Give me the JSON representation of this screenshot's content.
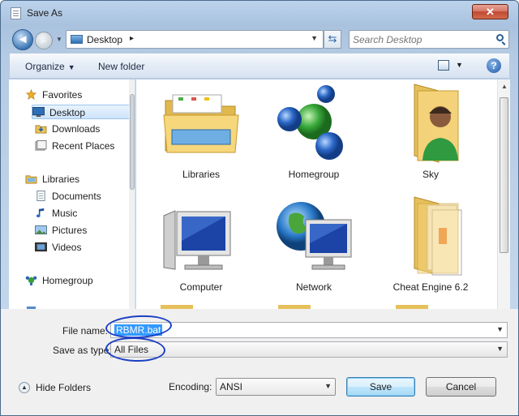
{
  "window": {
    "title": "Save As",
    "close_label": "✕"
  },
  "nav": {
    "back_glyph": "◄",
    "forward_glyph": "►",
    "address": "Desktop",
    "search_placeholder": "Search Desktop"
  },
  "toolbar": {
    "organize": "Organize",
    "new_folder": "New folder"
  },
  "sidebar": {
    "items": [
      {
        "label": "Favorites",
        "icon": "star-icon"
      },
      {
        "label": "Desktop",
        "icon": "desktop-icon",
        "selected": true
      },
      {
        "label": "Downloads",
        "icon": "downloads-icon"
      },
      {
        "label": "Recent Places",
        "icon": "recent-places-icon"
      },
      {
        "label": "Libraries",
        "icon": "library-icon"
      },
      {
        "label": "Documents",
        "icon": "documents-icon"
      },
      {
        "label": "Music",
        "icon": "music-icon"
      },
      {
        "label": "Pictures",
        "icon": "pictures-icon"
      },
      {
        "label": "Videos",
        "icon": "videos-icon"
      },
      {
        "label": "Homegroup",
        "icon": "homegroup-icon"
      }
    ]
  },
  "files": [
    {
      "name": "Libraries",
      "icon": "libraries-folder-icon"
    },
    {
      "name": "Homegroup",
      "icon": "homegroup-spheres-icon"
    },
    {
      "name": "Sky",
      "icon": "user-folder-icon"
    },
    {
      "name": "Computer",
      "icon": "computer-icon"
    },
    {
      "name": "Network",
      "icon": "network-icon"
    },
    {
      "name": "Cheat Engine 6.2",
      "icon": "folder-icon"
    }
  ],
  "form": {
    "file_name_label": "File name:",
    "file_name_value": "RBMR.bat",
    "save_type_label": "Save as type:",
    "save_type_value": "All Files",
    "hide_folders": "Hide Folders",
    "encoding_label": "Encoding:",
    "encoding_value": "ANSI",
    "save": "Save",
    "cancel": "Cancel"
  },
  "colors": {
    "selection": "#3399ff",
    "ink_annotation": "#1c3fc4",
    "title_close": "#c04a33"
  }
}
